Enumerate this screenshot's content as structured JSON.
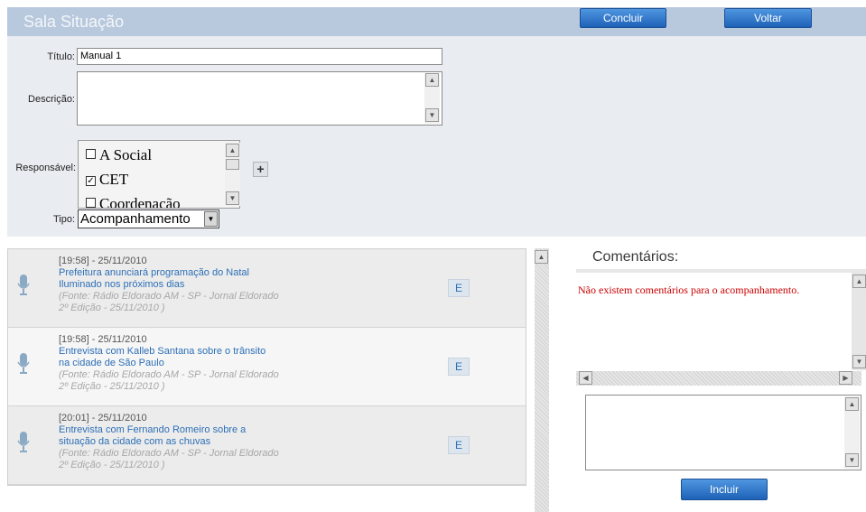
{
  "header": {
    "title": "Sala Situação",
    "conclude_label": "Concluir",
    "back_label": "Voltar"
  },
  "form": {
    "title_label": "Título:",
    "title_value": "Manual 1",
    "description_label": "Descrição:",
    "description_value": "",
    "responsible_label": "Responsável:",
    "responsible_options": [
      {
        "label": "A Social",
        "checked": false
      },
      {
        "label": "CET",
        "checked": true
      },
      {
        "label": "Coordenação",
        "checked": false
      }
    ],
    "add_label": "+",
    "type_label": "Tipo:",
    "type_value": "Acompanhamento"
  },
  "news": [
    {
      "time": "[19:58] - 25/11/2010",
      "title": "Prefeitura anunciará programação do Natal Iluminado nos próximos dias",
      "source": "(Fonte: Rádio Eldorado AM - SP - Jornal Eldorado 2º Edição - 25/11/2010 )",
      "action": "E"
    },
    {
      "time": "[19:58] - 25/11/2010",
      "title": "Entrevista com Kalleb Santana sobre o trânsito na cidade de São Paulo",
      "source": "(Fonte: Rádio Eldorado AM - SP - Jornal Eldorado 2º Edição - 25/11/2010 )",
      "action": "E"
    },
    {
      "time": "[20:01] - 25/11/2010",
      "title": "Entrevista com Fernando Romeiro sobre a situação da cidade com as chuvas",
      "source": "(Fonte: Rádio Eldorado AM - SP - Jornal Eldorado 2º Edição - 25/11/2010 )",
      "action": "E"
    }
  ],
  "comments": {
    "title": "Comentários:",
    "empty_message": "Não existem comentários para o acompanhamento.",
    "include_label": "Incluir"
  },
  "colors": {
    "header_bg": "#b9c9dd",
    "button_blue": "#1e62b8",
    "link_blue": "#2d6fb6",
    "error_red": "#cc0000"
  }
}
